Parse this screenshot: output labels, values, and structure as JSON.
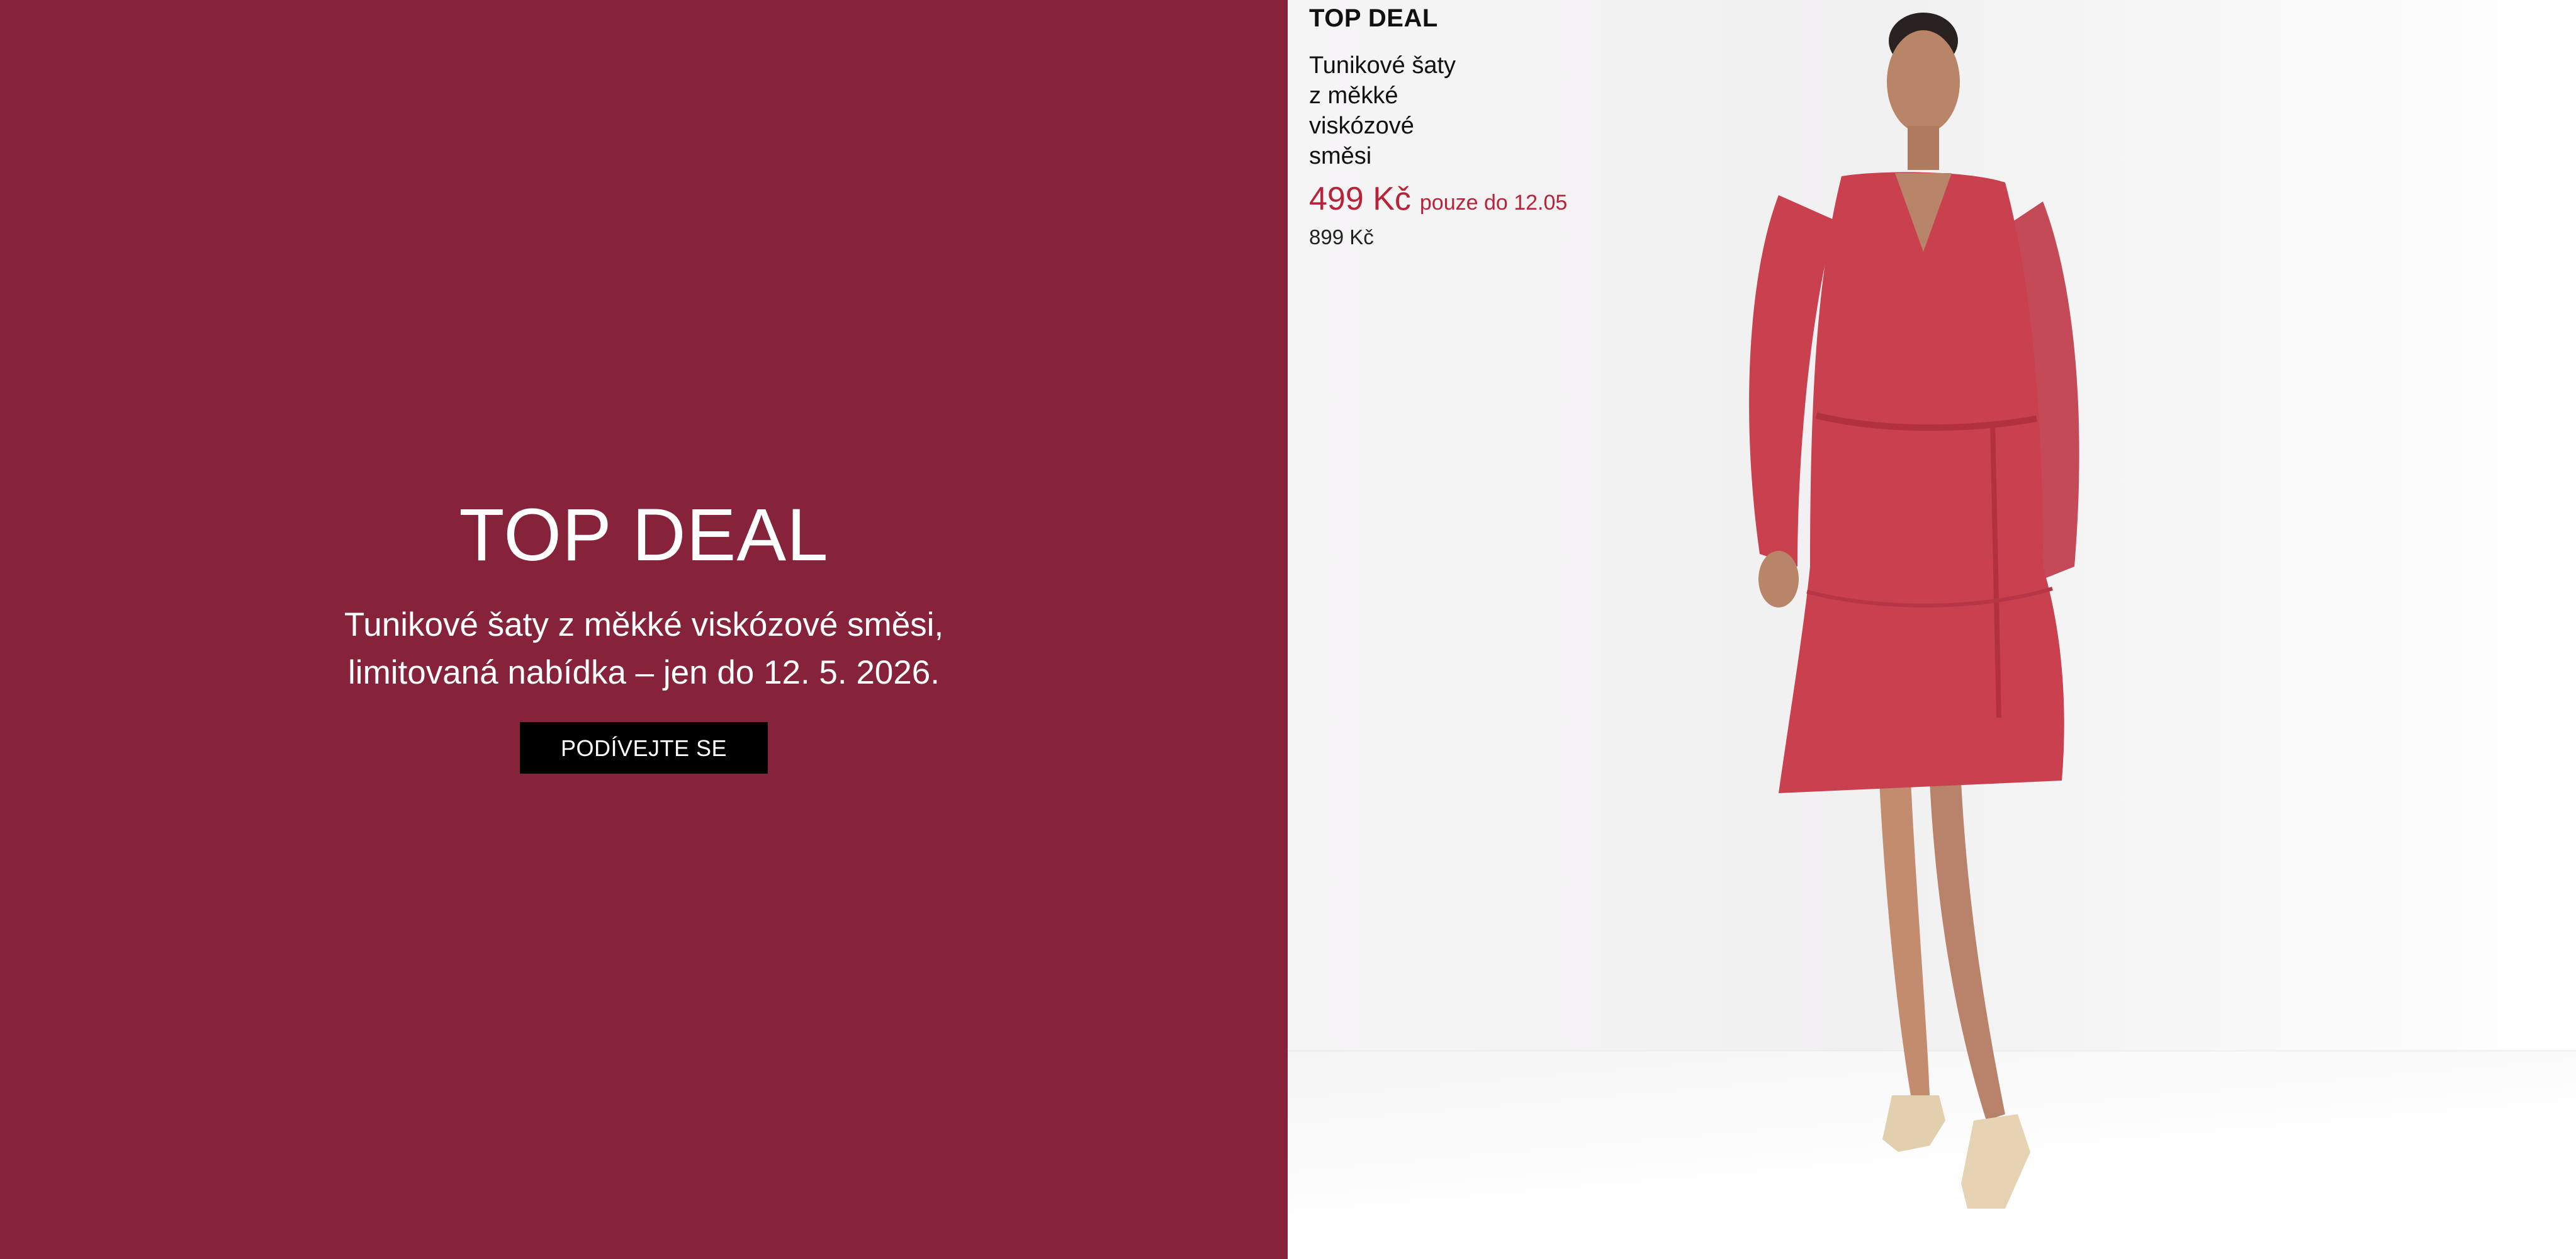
{
  "promo": {
    "title": "TOP DEAL",
    "description_line1": "Tunikové šaty z měkké viskózové směsi,",
    "description_line2": "limitovaná nabídka – jen do 12. 5. 2026.",
    "button_label": "PODÍVEJTE SE"
  },
  "product": {
    "badge": "TOP DEAL",
    "name": "Tunikové šaty z měkké viskózové směsi",
    "price_new": "499 Kč",
    "price_note": "pouze do 12.05",
    "price_old": "899 Kč"
  },
  "colors": {
    "promo_background": "#86233a",
    "button_background": "#000000",
    "price_accent": "#b82339",
    "dress": "#c9404f"
  },
  "image": {
    "description_icon": "model-in-red-dress-icon"
  }
}
